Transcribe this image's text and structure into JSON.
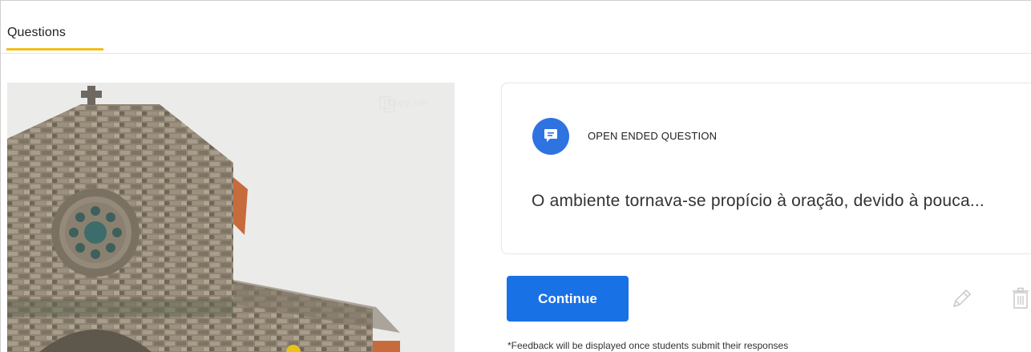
{
  "tabs": [
    {
      "label": "Questions",
      "active": true
    }
  ],
  "media": {
    "copy_link_label": "Copy link",
    "copy_icon": "copy-icon"
  },
  "question": {
    "type_label": "OPEN ENDED QUESTION",
    "type_icon": "comment-icon",
    "text": "O ambiente tornava-se propício à oração, devido à pouca..."
  },
  "actions": {
    "continue_label": "Continue",
    "edit_icon": "pencil-icon",
    "delete_icon": "trash-icon"
  },
  "footer_note": "*Feedback will be displayed once students submit their responses",
  "colors": {
    "accent_tab": "#f2bd1d",
    "primary": "#1971e6",
    "badge": "#2f73e0"
  }
}
